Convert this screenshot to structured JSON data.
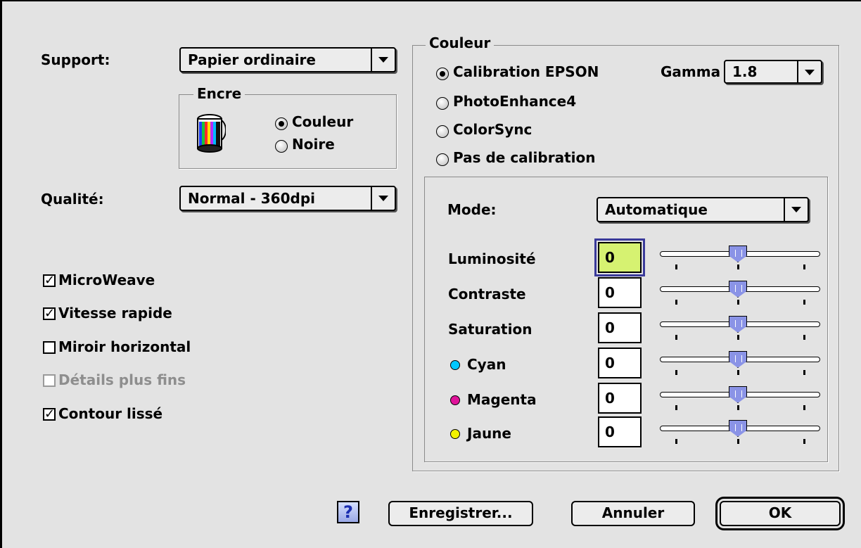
{
  "support": {
    "label": "Support:",
    "value": "Papier ordinaire"
  },
  "encre": {
    "title": "Encre",
    "options": [
      "Couleur",
      "Noire"
    ],
    "selected": "Couleur"
  },
  "qualite": {
    "label": "Qualité:",
    "value": "Normal - 360dpi"
  },
  "checkboxes": [
    {
      "label": "MicroWeave",
      "checked": true,
      "enabled": true
    },
    {
      "label": "Vitesse rapide",
      "checked": true,
      "enabled": true
    },
    {
      "label": "Miroir horizontal",
      "checked": false,
      "enabled": true
    },
    {
      "label": "Détails plus fins",
      "checked": false,
      "enabled": false
    },
    {
      "label": "Contour lissé",
      "checked": true,
      "enabled": true
    }
  ],
  "couleur": {
    "title": "Couleur",
    "options": [
      "Calibration EPSON",
      "PhotoEnhance4",
      "ColorSync",
      "Pas de calibration"
    ],
    "selected": "Calibration EPSON",
    "gamma": {
      "label": "Gamma",
      "value": "1.8"
    }
  },
  "mode": {
    "label": "Mode:",
    "value": "Automatique"
  },
  "adjustments": [
    {
      "label": "Luminosité",
      "value": "0",
      "focused": true
    },
    {
      "label": "Contraste",
      "value": "0"
    },
    {
      "label": "Saturation",
      "value": "0"
    },
    {
      "label": "Cyan",
      "value": "0",
      "dot_color": "#00c8ff"
    },
    {
      "label": "Magenta",
      "value": "0",
      "dot_color": "#e0139a"
    },
    {
      "label": "Jaune",
      "value": "0",
      "dot_color": "#f2f200"
    }
  ],
  "buttons": {
    "help": "?",
    "save": "Enregistrer...",
    "cancel": "Annuler",
    "ok": "OK"
  },
  "colors": {
    "background": "#e3e3e3",
    "focus_field": "#d6f271",
    "slider_thumb": "#8a93e6"
  }
}
